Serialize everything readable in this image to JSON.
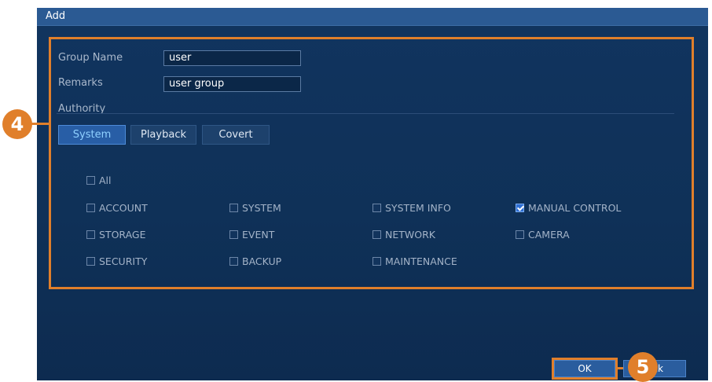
{
  "dialog": {
    "title": "Add"
  },
  "form": {
    "group_name_label": "Group Name",
    "group_name_value": "user",
    "remarks_label": "Remarks",
    "remarks_value": "user group",
    "authority_label": "Authority"
  },
  "tabs": [
    {
      "label": "System",
      "active": true
    },
    {
      "label": "Playback",
      "active": false
    },
    {
      "label": "Covert",
      "active": false
    }
  ],
  "permissions": {
    "all": {
      "label": "All",
      "checked": false
    },
    "rows": [
      [
        {
          "label": "ACCOUNT",
          "checked": false
        },
        {
          "label": "SYSTEM",
          "checked": false
        },
        {
          "label": "SYSTEM INFO",
          "checked": false
        },
        {
          "label": "MANUAL CONTROL",
          "checked": true
        }
      ],
      [
        {
          "label": "STORAGE",
          "checked": false
        },
        {
          "label": "EVENT",
          "checked": false
        },
        {
          "label": "NETWORK",
          "checked": false
        },
        {
          "label": "CAMERA",
          "checked": false
        }
      ],
      [
        {
          "label": "SECURITY",
          "checked": false
        },
        {
          "label": "BACKUP",
          "checked": false
        },
        {
          "label": "MAINTENANCE",
          "checked": false
        }
      ]
    ]
  },
  "footer": {
    "ok_label": "OK",
    "back_label": "Back",
    "back_visible_text": "ck"
  },
  "callouts": {
    "form_step": "4",
    "ok_step": "5"
  },
  "colors": {
    "highlight": "#e07f2b",
    "dialog_bg": "#11345f",
    "titlebar": "#2b5a93",
    "checkbox_checked": "#2f6fd3"
  }
}
